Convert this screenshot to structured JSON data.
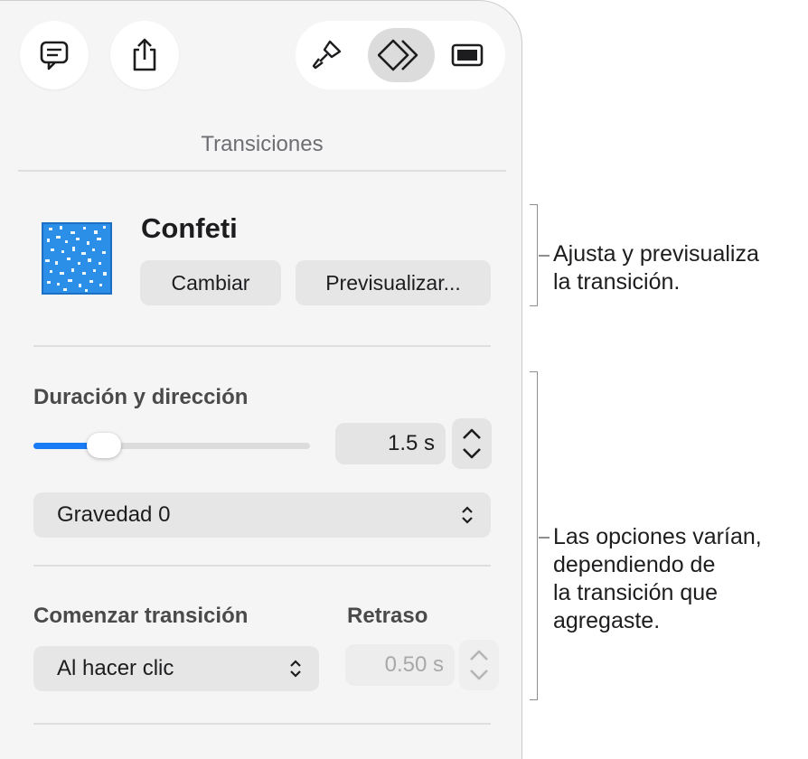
{
  "toolbar": {
    "comment_icon": "comment-bubble-icon",
    "share_icon": "share-icon",
    "format_icon": "paintbrush-icon",
    "animate_icon": "animate-diamond-icon",
    "document_icon": "slide-document-icon"
  },
  "panel": {
    "tab_title": "Transiciones"
  },
  "transition": {
    "name": "Confeti",
    "change_label": "Cambiar",
    "preview_label": "Previsualizar..."
  },
  "duration": {
    "label": "Duración y dirección",
    "value": "1.5 s",
    "slider_fraction": 0.27,
    "direction_value": "Gravedad 0"
  },
  "start": {
    "label": "Comenzar transición",
    "value": "Al hacer clic",
    "delay_label": "Retraso",
    "delay_value": "0.50 s"
  },
  "callouts": {
    "first": "Ajusta y previsualiza\nla transición.",
    "second": "Las opciones varían,\ndependiendo de\nla transición que\nagregaste."
  },
  "colors": {
    "accent": "#1a7cf5",
    "panel_bg": "#f5f5f5",
    "thumbnail_blue": "#2b8fe8"
  }
}
